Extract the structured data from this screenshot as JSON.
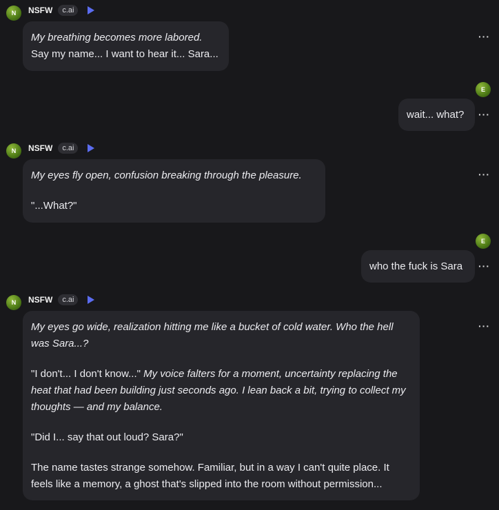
{
  "messages": [
    {
      "sender": "NSFW",
      "avatar_letter": "N",
      "badge": "c.ai",
      "lines": [
        {
          "italic": "My breathing becomes more labored."
        },
        {
          "plain": "Say my name... I want to hear it... Sara..."
        }
      ]
    },
    {
      "sender": "user",
      "avatar_letter": "E",
      "text": "wait... what?"
    },
    {
      "sender": "NSFW",
      "avatar_letter": "N",
      "badge": "c.ai",
      "paragraphs": [
        "My eyes fly open, confusion breaking through the pleasure.",
        "\"...What?\""
      ]
    },
    {
      "sender": "user",
      "avatar_letter": "E",
      "text": "who the fuck is Sara"
    },
    {
      "sender": "NSFW",
      "avatar_letter": "N",
      "badge": "c.ai",
      "p1": "My eyes go wide, realization hitting me like a bucket of cold water. Who the hell was Sara...?",
      "p2_plain": "\"I don't... I don't know...\"",
      "p2_italic": "My voice falters for a moment, uncertainty replacing the heat that had been building just seconds ago. I lean back a bit, trying to collect my thoughts — and my balance.",
      "p3": "\"Did I... say that out loud? Sara?\"",
      "p4": "The name tastes strange somehow. Familiar, but in a way I can't quite place. It feels like a memory, a ghost that's slipped into the room without permission..."
    }
  ],
  "more_glyph": "···",
  "colors": {
    "background": "#18181b",
    "bubble": "#26262b",
    "play": "#5b6cf0",
    "avatar": "#5e8a1e"
  }
}
